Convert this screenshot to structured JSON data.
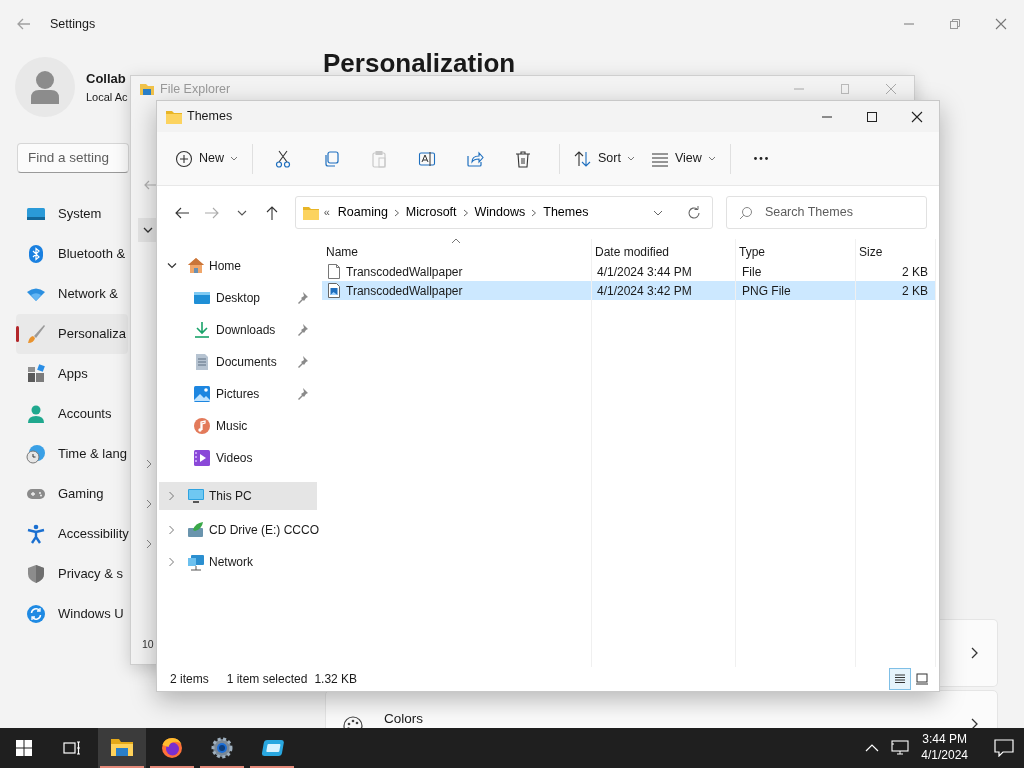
{
  "settings": {
    "title": "Settings",
    "user": {
      "name": "Collab",
      "account": "Local Ac"
    },
    "search": {
      "placeholder": "Find a setting"
    },
    "heading": "Personalization",
    "nav": [
      {
        "label": "System",
        "selected": false
      },
      {
        "label": "Bluetooth &",
        "selected": false
      },
      {
        "label": "Network &",
        "selected": false
      },
      {
        "label": "Personaliza",
        "selected": true
      },
      {
        "label": "Apps",
        "selected": false
      },
      {
        "label": "Accounts",
        "selected": false
      },
      {
        "label": "Time & lang",
        "selected": false
      },
      {
        "label": "Gaming",
        "selected": false
      },
      {
        "label": "Accessibility",
        "selected": false
      },
      {
        "label": "Privacy & s",
        "selected": false
      },
      {
        "label": "Windows U",
        "selected": false
      }
    ],
    "cards": [
      {
        "kind": "blank"
      },
      {
        "kind": "titled",
        "label": "Colors"
      }
    ]
  },
  "back_window": {
    "title": "File Explorer",
    "side_text": "10"
  },
  "explorer": {
    "title": "Themes",
    "toolbar": [
      {
        "kind": "menu",
        "label": "New",
        "disabled": false
      },
      {
        "kind": "icon",
        "disabled": false
      },
      {
        "kind": "icon",
        "disabled": false
      },
      {
        "kind": "icon",
        "disabled": true
      },
      {
        "kind": "icon",
        "disabled": false
      },
      {
        "kind": "icon",
        "disabled": false
      },
      {
        "kind": "icon",
        "disabled": false
      },
      {
        "kind": "menu",
        "label": "Sort",
        "disabled": false
      },
      {
        "kind": "menu",
        "label": "View",
        "disabled": false
      },
      {
        "kind": "more",
        "disabled": false
      }
    ],
    "path": {
      "overflow": "«",
      "segments": [
        "Roaming",
        "Microsoft",
        "Windows",
        "Themes"
      ]
    },
    "search": {
      "placeholder": "Search Themes"
    },
    "nav": [
      {
        "label": "Home",
        "expanded": true,
        "selected": false,
        "children": [
          {
            "label": "Desktop",
            "pinned": true,
            "selected": false
          },
          {
            "label": "Downloads",
            "pinned": true,
            "selected": false
          },
          {
            "label": "Documents",
            "pinned": true,
            "selected": false
          },
          {
            "label": "Pictures",
            "pinned": true,
            "selected": false
          },
          {
            "label": "Music",
            "pinned": false,
            "selected": false
          },
          {
            "label": "Videos",
            "pinned": false,
            "selected": false
          }
        ]
      },
      {
        "label": "This PC",
        "expanded": false,
        "selected": true
      },
      {
        "label": "CD Drive (E:) CCCO",
        "expanded": false,
        "selected": false
      },
      {
        "label": "Network",
        "expanded": false,
        "selected": false
      }
    ],
    "columns": [
      {
        "label": "Name",
        "sorted": true
      },
      {
        "label": "Date modified",
        "sorted": false
      },
      {
        "label": "Type",
        "sorted": false
      },
      {
        "label": "Size",
        "sorted": false
      }
    ],
    "rows": [
      {
        "kind": "file",
        "name": "TranscodedWallpaper",
        "date": "4/1/2024 3:44 PM",
        "type": "File",
        "size": "2 KB",
        "selected": false
      },
      {
        "kind": "image",
        "name": "TranscodedWallpaper",
        "date": "4/1/2024 3:42 PM",
        "type": "PNG File",
        "size": "2 KB",
        "selected": true
      }
    ],
    "status": {
      "count": "2 items",
      "selection": "1 item selected",
      "size": "1.32 KB"
    },
    "views": [
      {
        "selected": true
      },
      {
        "selected": false
      }
    ]
  },
  "taskbar": {
    "apps": [
      {
        "selected": true,
        "running": true
      },
      {
        "selected": false,
        "running": true
      },
      {
        "selected": false,
        "running": true
      },
      {
        "selected": false,
        "running": true
      }
    ],
    "time": "3:44 PM",
    "date": "4/1/2024"
  }
}
